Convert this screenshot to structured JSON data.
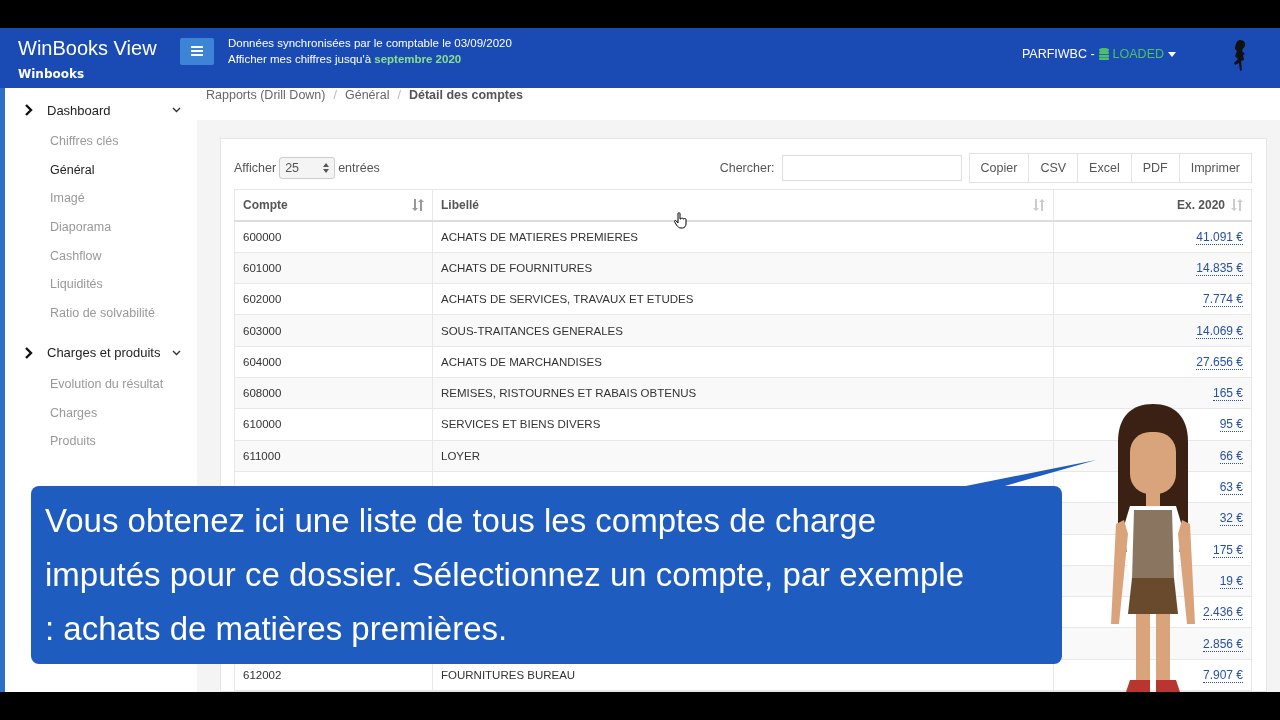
{
  "header": {
    "app_title": "WinBooks View",
    "subtitle": "Winbooks",
    "sync_line": "Données synchronisées par le comptable le 03/09/2020",
    "period_line": "Afficher mes chiffres jusqu'à **septembre 2020**",
    "account": "PARFIWBC -",
    "status": "LOADED"
  },
  "sidebar": {
    "sections": [
      {
        "label": "Dashboard",
        "expanded": true,
        "items": [
          {
            "label": "Chiffres clés",
            "selected": false
          },
          {
            "label": "Général",
            "selected": true
          },
          {
            "label": "Imagé",
            "selected": false
          },
          {
            "label": "Diaporama",
            "selected": false
          },
          {
            "label": "Cashflow",
            "selected": false
          },
          {
            "label": "Liquidités",
            "selected": false
          },
          {
            "label": "Ratio de solvabilité",
            "selected": false
          }
        ]
      },
      {
        "label": "Charges et produits",
        "expanded": true,
        "items": [
          {
            "label": "Evolution du résultat",
            "selected": false
          },
          {
            "label": "Charges",
            "selected": false
          },
          {
            "label": "Produits",
            "selected": false
          }
        ]
      }
    ]
  },
  "breadcrumb": [
    "Rapports (Drill Down)",
    "Général",
    "Détail des comptes"
  ],
  "breadcrumb_separator": "/",
  "table_controls": {
    "show_label": "Afficher",
    "page_size": "25",
    "entries_label": "entrées",
    "search_label": "Chercher:",
    "buttons": [
      "Copier",
      "CSV",
      "Excel",
      "PDF",
      "Imprimer"
    ]
  },
  "table": {
    "columns": [
      "Compte",
      "Libellé",
      "Ex. 2020"
    ],
    "rows": [
      {
        "compte": "600000",
        "libelle": "ACHATS DE MATIERES PREMIERES",
        "amount": "41.091 €"
      },
      {
        "compte": "601000",
        "libelle": "ACHATS DE FOURNITURES",
        "amount": "14.835 €"
      },
      {
        "compte": "602000",
        "libelle": "ACHATS DE SERVICES, TRAVAUX ET ETUDES",
        "amount": "7.774 €"
      },
      {
        "compte": "603000",
        "libelle": "SOUS-TRAITANCES GENERALES",
        "amount": "14.069 €"
      },
      {
        "compte": "604000",
        "libelle": "ACHATS DE MARCHANDISES",
        "amount": "27.656 €"
      },
      {
        "compte": "608000",
        "libelle": "REMISES, RISTOURNES ET RABAIS OBTENUS",
        "amount": "165 €"
      },
      {
        "compte": "610000",
        "libelle": "SERVICES ET BIENS DIVERS",
        "amount": "95 €"
      },
      {
        "compte": "611000",
        "libelle": "LOYER",
        "amount": "66 €"
      },
      {
        "amount": "63 €"
      },
      {
        "amount": "32 €"
      },
      {
        "amount": "175 €"
      },
      {
        "amount": "19 €"
      },
      {
        "amount": "2.436 €"
      },
      {
        "amount": "2.856 €"
      },
      {
        "compte": "612002",
        "libelle": "FOURNITURES BUREAU",
        "amount": "7.907 €"
      }
    ]
  },
  "caption": "Vous obtenez ici une liste de tous les comptes de charge imputés pour ce dossier. Sélectionnez un compte, par exemple : achats de matières premières."
}
